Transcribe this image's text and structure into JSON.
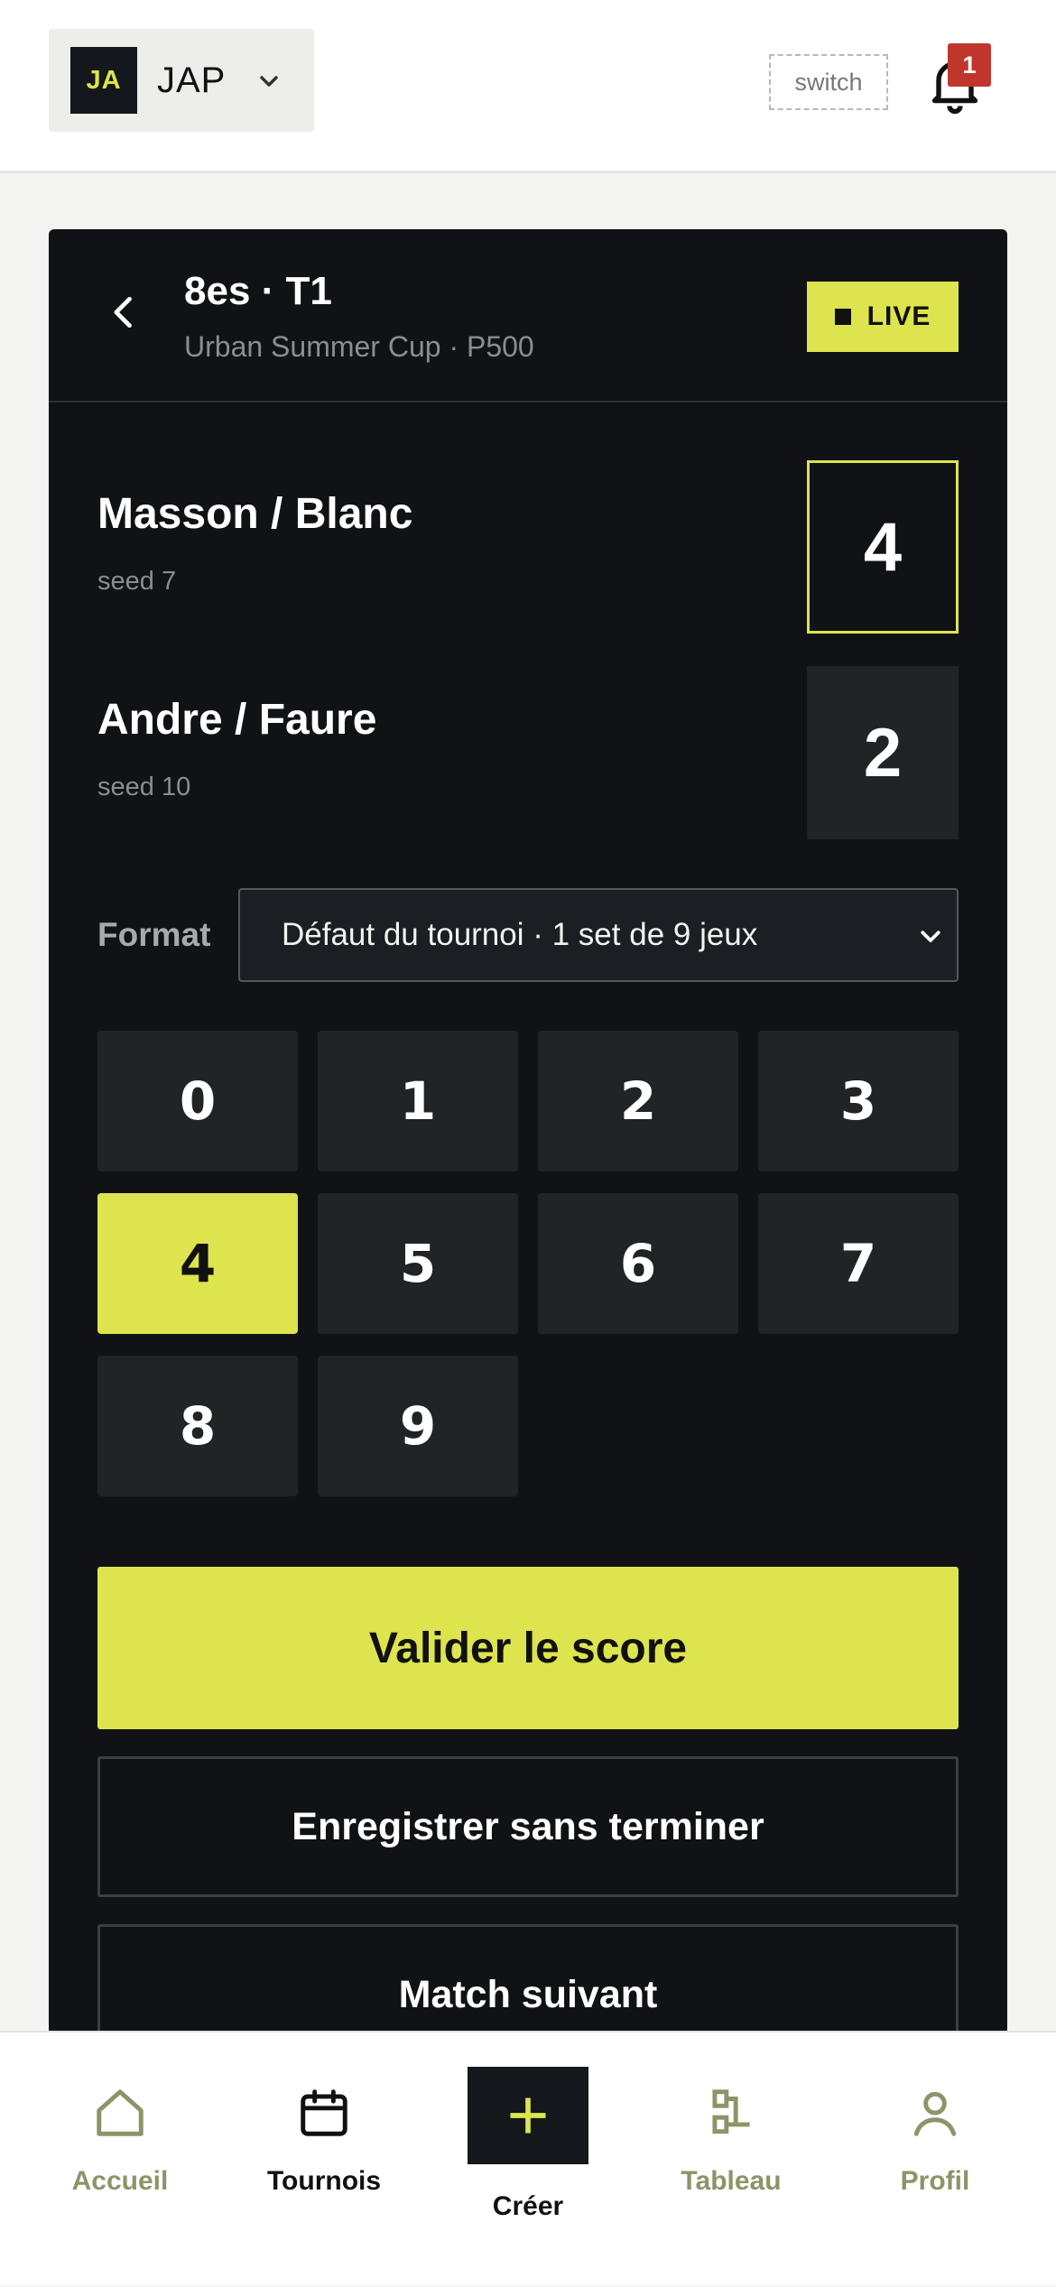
{
  "header": {
    "avatar_initials": "JA",
    "account_name": "JAP",
    "switch_label": "switch",
    "notification_count": "1"
  },
  "match": {
    "round_title": "8es · T1",
    "subtitle": "Urban Summer Cup · P500",
    "live_label": "LIVE",
    "team1": {
      "name": "Masson / Blanc",
      "seed": "seed 7",
      "score": "4"
    },
    "team2": {
      "name": "Andre / Faure",
      "seed": "seed 10",
      "score": "2"
    },
    "format_label": "Format",
    "format_value": "Défaut du tournoi · 1 set de 9 jeux",
    "keypad": [
      "0",
      "1",
      "2",
      "3",
      "4",
      "5",
      "6",
      "7",
      "8",
      "9"
    ],
    "keypad_selected": "4",
    "validate_label": "Valider le score",
    "save_label": "Enregistrer sans terminer",
    "next_label": "Match suivant"
  },
  "nav": {
    "home": "Accueil",
    "tournaments": "Tournois",
    "create": "Créer",
    "board": "Tableau",
    "profile": "Profil"
  },
  "colors": {
    "accent": "#dde44d",
    "card_bg": "#101215",
    "tile_bg": "#212427",
    "badge_red": "#c0362c",
    "nav_muted": "#8d9468"
  }
}
